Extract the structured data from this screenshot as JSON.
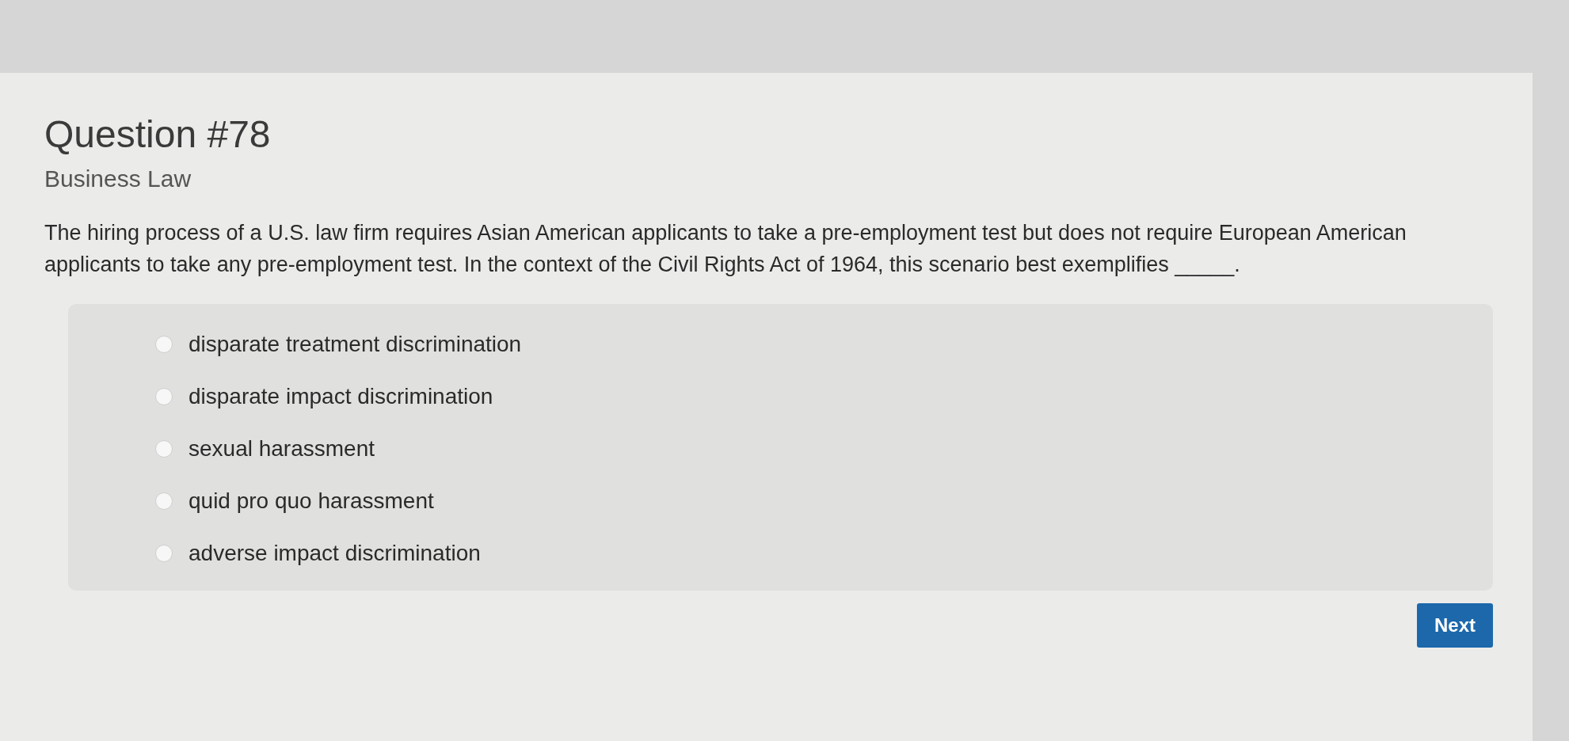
{
  "header": {
    "title": "Question #78",
    "subject": "Business Law"
  },
  "question": {
    "text": "The hiring process of a U.S. law firm requires Asian American applicants to take a pre-employment test but does not require European American applicants to take any pre-employment test. In the context of the Civil Rights Act of 1964, this scenario best exemplifies _____."
  },
  "options": [
    {
      "label": "disparate treatment discrimination",
      "selected": false
    },
    {
      "label": "disparate impact discrimination",
      "selected": false
    },
    {
      "label": "sexual harassment",
      "selected": false
    },
    {
      "label": "quid pro quo harassment",
      "selected": false
    },
    {
      "label": "adverse impact discrimination",
      "selected": false
    }
  ],
  "buttons": [
    {
      "label": "Next"
    }
  ]
}
